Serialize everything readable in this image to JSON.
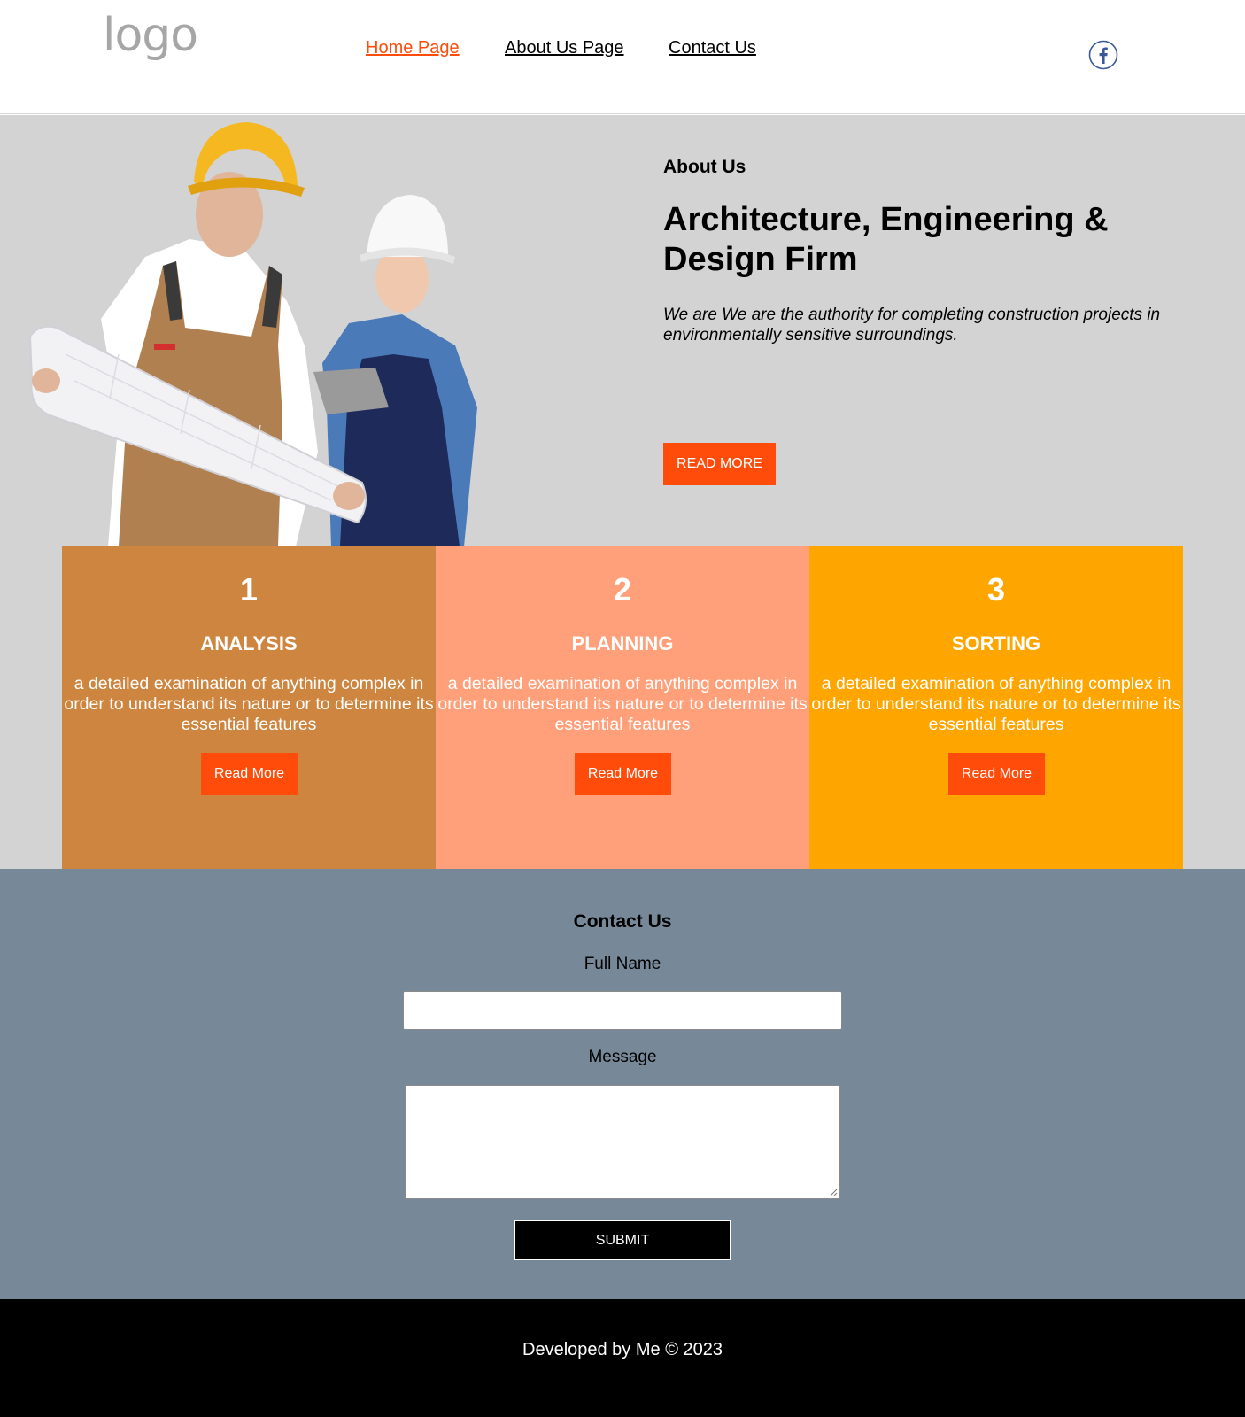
{
  "header": {
    "logo_text": "logo",
    "nav": {
      "home": "Home Page",
      "about": "About Us Page",
      "contact": "Contact Us"
    },
    "social_icon": "facebook-icon"
  },
  "hero": {
    "label": "About Us",
    "title": "Architecture, Engineering & Design Firm",
    "description": "We are We are the authority for completing construction projects in environmentally sensitive surroundings.",
    "button": "READ MORE",
    "image": "two construction workers in hard hats viewing a blueprint and tablet"
  },
  "cards": [
    {
      "number": "1",
      "title": "ANALYSIS",
      "text": "a detailed examination of anything complex in order to understand its nature or to determine its essential features",
      "button": "Read More",
      "color": "#cd853f"
    },
    {
      "number": "2",
      "title": "PLANNING",
      "text": "a detailed examination of anything complex in order to understand its nature or to determine its essential features",
      "button": "Read More",
      "color": "#ffa07a"
    },
    {
      "number": "3",
      "title": "SORTING",
      "text": "a detailed examination of anything complex in order to understand its nature or to determine its essential features",
      "button": "Read More",
      "color": "#ffa500"
    }
  ],
  "contact": {
    "title": "Contact Us",
    "name_label": "Full Name",
    "name_value": "",
    "message_label": "Message",
    "message_value": "",
    "submit": "SUBMIT"
  },
  "footer": {
    "text": "Developed by Me © 2023"
  },
  "colors": {
    "accent": "#ff4c0b",
    "hero_bg": "#d3d3d3",
    "contact_bg": "#778899",
    "footer_bg": "#000000"
  }
}
